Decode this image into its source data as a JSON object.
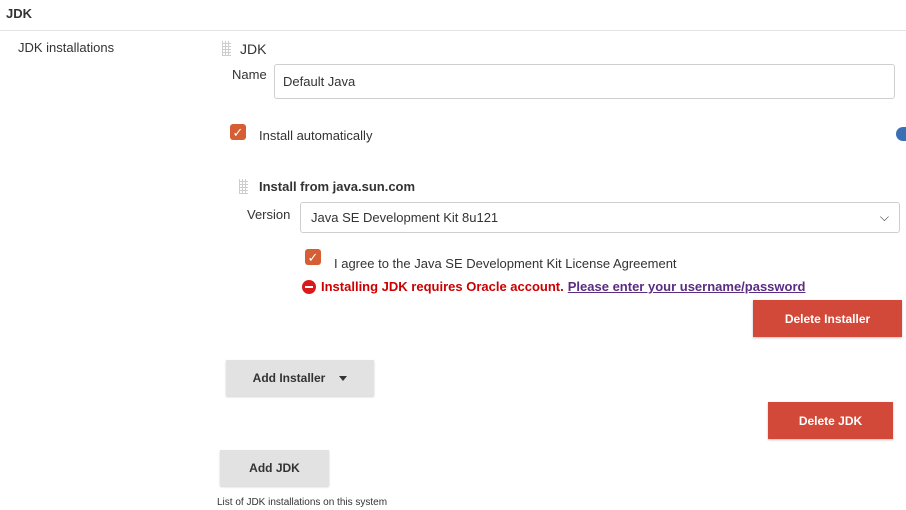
{
  "section": {
    "title": "JDK"
  },
  "jdk_installations": {
    "label": "JDK installations",
    "block_title": "JDK",
    "name_label": "Name",
    "name_value": "Default Java",
    "install_automatically_label": "Install automatically",
    "install_automatically_checked": true
  },
  "installer": {
    "title": "Install from java.sun.com",
    "version_label": "Version",
    "version_value": "Java SE Development Kit 8u121",
    "license_label": "I agree to the Java SE Development Kit License Agreement",
    "license_checked": true,
    "error_text": "Installing JDK requires Oracle account.",
    "error_link": "Please enter your username/password",
    "delete_installer_label": "Delete Installer"
  },
  "actions": {
    "add_installer_label": "Add Installer",
    "delete_jdk_label": "Delete JDK",
    "add_jdk_label": "Add JDK"
  },
  "help": {
    "note": "List of JDK installations on this system"
  },
  "colors": {
    "checkbox": "#d55e34",
    "danger_button": "#d24939",
    "error_text": "#cc0000",
    "link": "#5a2c82",
    "neutral_button": "#e2e2e2"
  },
  "icons": {
    "grip": "drag-handle-icon",
    "check": "checkmark-icon",
    "error": "error-minus-circle-icon",
    "dropdown": "chevron-down-icon",
    "help": "help-icon"
  }
}
